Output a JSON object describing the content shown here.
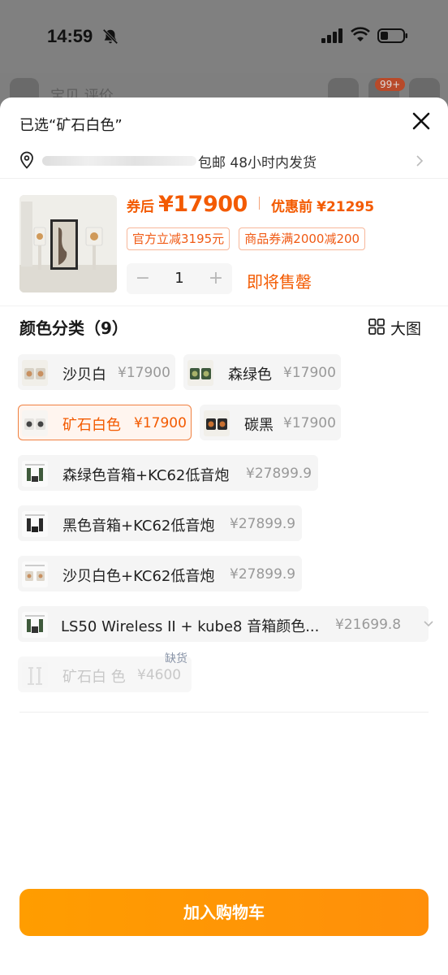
{
  "status_bar": {
    "time": "14:59"
  },
  "background_page": {
    "ghost_text": "宝贝 评价",
    "cart_badge": "99+"
  },
  "sheet": {
    "selected_label": "已选“矿石白色”",
    "address": {
      "text": "包邮 48小时内发货"
    },
    "price": {
      "after_coupon_label": "券后",
      "after_coupon_value": "¥17900",
      "before_label": "优惠前",
      "before_value": "¥21295"
    },
    "discount_chips": [
      "官方立减3195元",
      "商品券满2000减200"
    ],
    "quantity": {
      "minus": "−",
      "value": "1",
      "plus": "+"
    },
    "presale_label": "即将售罄",
    "section_title": "颜色分类（9）",
    "big_image_label": "大图",
    "options": [
      {
        "name": "沙贝白",
        "price": "¥17900"
      },
      {
        "name": "森绿色",
        "price": "¥17900"
      },
      {
        "name": "矿石白色",
        "price": "¥17900"
      },
      {
        "name": "碳黑",
        "price": "¥17900"
      },
      {
        "name": "森绿色音箱+KC62低音炮",
        "price": "¥27899.9"
      },
      {
        "name": "黑色音箱+KC62低音炮",
        "price": "¥27899.9"
      },
      {
        "name": "沙贝白色+KC62低音炮",
        "price": "¥27899.9"
      },
      {
        "name": "LS50 Wireless II + kube8 音箱颜色...",
        "price": "¥21699.8"
      },
      {
        "name": "矿石白 色",
        "price": "¥4600"
      }
    ],
    "selected_option_index": 2,
    "out_of_stock_label": "缺货",
    "add_to_cart_label": "加入购物车",
    "colors": {
      "accent": "#f35a00",
      "button": "#ff9500",
      "selected_border": "#f08040"
    }
  }
}
